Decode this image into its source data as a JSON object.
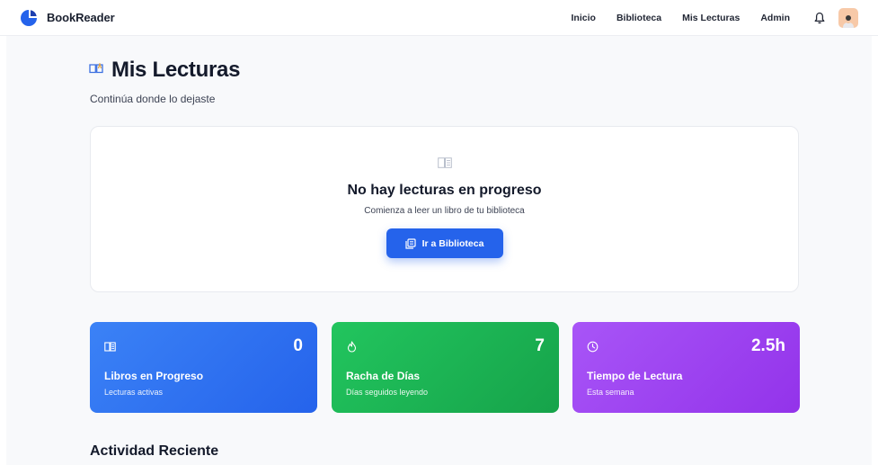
{
  "app": {
    "name": "BookReader",
    "brand_color": "#2563eb"
  },
  "nav": {
    "links": [
      "Inicio",
      "Biblioteca",
      "Mis Lecturas",
      "Admin"
    ],
    "icons": {
      "notifications": "bell-icon",
      "profile": "avatar"
    }
  },
  "header": {
    "title": "Mis Lecturas",
    "subtitle": "Continúa donde lo dejaste"
  },
  "empty_state": {
    "title": "No hay lecturas en progreso",
    "subtitle": "Comienza a leer un libro de tu biblioteca",
    "button_label": "Ir a Biblioteca"
  },
  "stats": [
    {
      "value": "0",
      "label": "Libros en Progreso",
      "desc": "Lecturas activas",
      "icon": "book-open-icon",
      "color": "#2563eb"
    },
    {
      "value": "7",
      "label": "Racha de Días",
      "desc": "Días seguidos leyendo",
      "icon": "flame-icon",
      "color": "#16a34a"
    },
    {
      "value": "2.5h",
      "label": "Tiempo de Lectura",
      "desc": "Esta semana",
      "icon": "clock-icon",
      "color": "#9333ea"
    }
  ],
  "sections": {
    "recent_activity": "Actividad Reciente"
  }
}
